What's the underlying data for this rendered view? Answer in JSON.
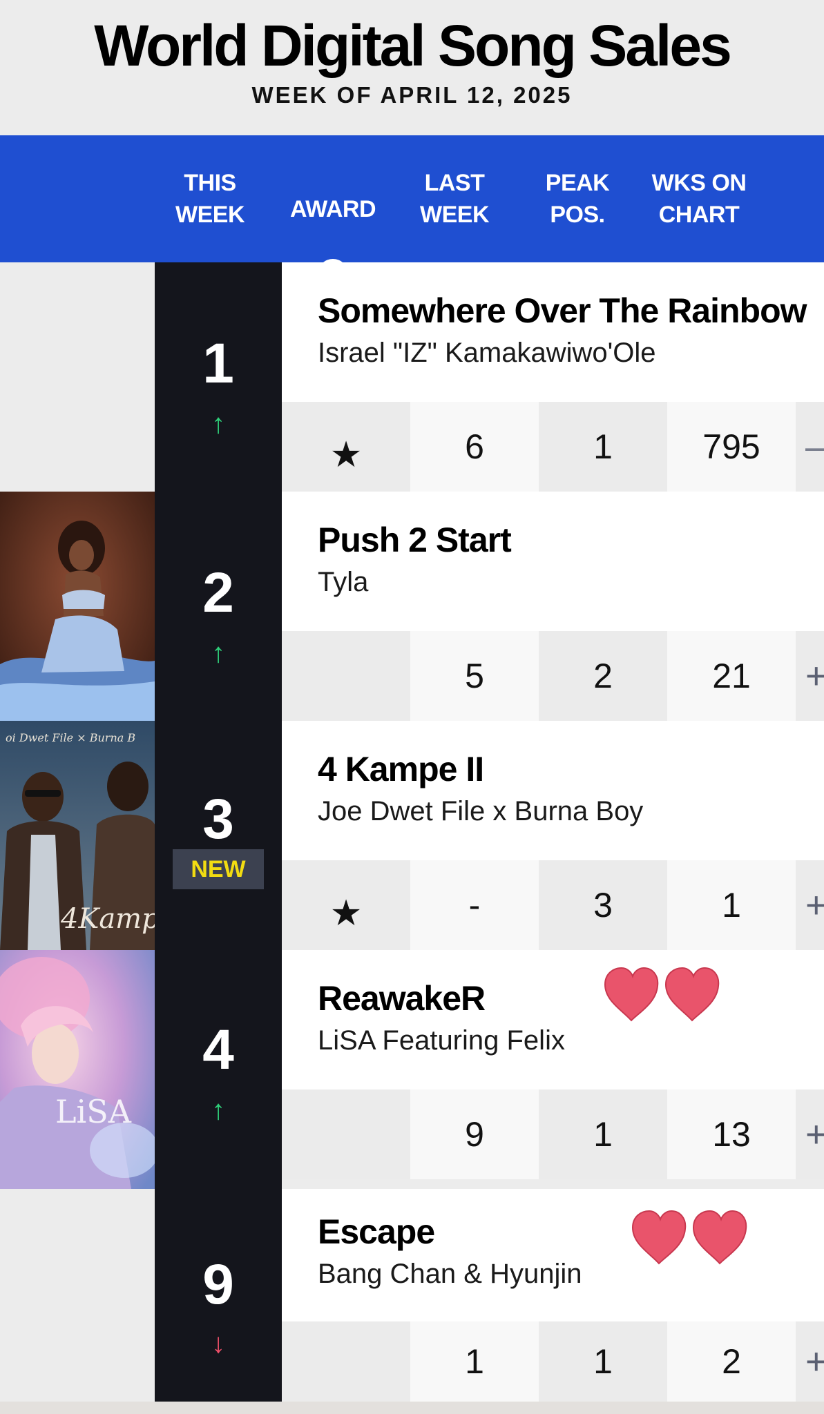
{
  "chart": {
    "title": "World Digital Song Sales",
    "week": "WEEK OF APRIL 12, 2025"
  },
  "columns": {
    "this_week": "THIS\nWEEK",
    "award": "AWARD",
    "award_info_icon": "i",
    "last_week": "LAST\nWEEK",
    "peak": "PEAK\nPOS.",
    "wks": "WKS ON\nCHART"
  },
  "entries": [
    {
      "rank": "1",
      "movement": "up",
      "arrow": "↑",
      "title": "Somewhere Over The Rainbow",
      "artist": "Israel \"IZ\" Kamakawiwo'Ole",
      "award": "★",
      "last_week": "6",
      "peak": "1",
      "weeks": "795",
      "more": "+",
      "hearts": false,
      "new": false
    },
    {
      "rank": "2",
      "movement": "up",
      "arrow": "↑",
      "title": "Push 2 Start",
      "artist": "Tyla",
      "award": "",
      "last_week": "5",
      "peak": "2",
      "weeks": "21",
      "more": "+",
      "hearts": false,
      "new": false
    },
    {
      "rank": "3",
      "movement": "new",
      "badge": "NEW",
      "title": "4 Kampe II",
      "artist": "Joe Dwet File x Burna Boy",
      "award": "★",
      "last_week": "-",
      "peak": "3",
      "weeks": "1",
      "more": "+",
      "hearts": false,
      "new": true
    },
    {
      "rank": "4",
      "movement": "up",
      "arrow": "↑",
      "title": "ReawakeR",
      "artist": "LiSA Featuring Felix",
      "award": "",
      "last_week": "9",
      "peak": "1",
      "weeks": "13",
      "more": "+",
      "hearts": true,
      "new": false
    },
    {
      "rank": "9",
      "movement": "down",
      "arrow": "↓",
      "title": "Escape",
      "artist": "Bang Chan & Hyunjin",
      "award": "",
      "last_week": "1",
      "peak": "1",
      "weeks": "2",
      "more": "+",
      "hearts": true,
      "new": false
    }
  ],
  "colors": {
    "header_bar": "#1f4fd1",
    "rank_column": "#14151c",
    "arrow_up": "#2fd07a",
    "arrow_down": "#f0506a",
    "new_badge_text": "#f2dc12",
    "heart": "#e9546b"
  },
  "icons": {
    "award": "star-icon",
    "heart": "heart-icon",
    "info": "info-icon"
  }
}
